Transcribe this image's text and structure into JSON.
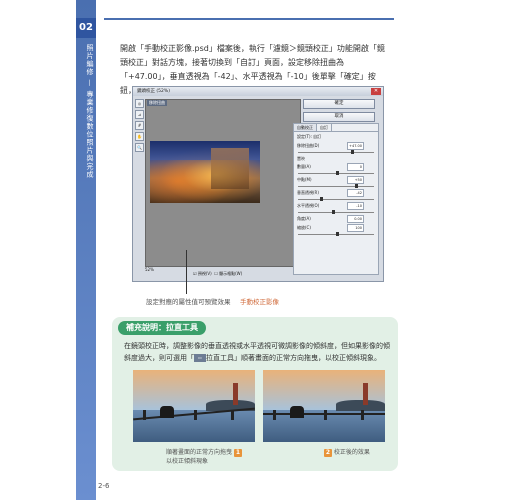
{
  "chapter": {
    "number": "02",
    "side_text": "照片編修 — 專業修復數位照片與完成"
  },
  "body_paragraph": "開啟「手動校正影像.psd」檔案後，執行「濾鏡＞鏡頭校正」功能開啟「鏡頭校正」對話方塊，接著切換到「自訂」頁面，設定移除扭曲為「+47.00」，垂直透視為「-42」、水平透視為「-10」後單擊「確定」按鈕，以校正影像。",
  "dialog": {
    "title": "鏡頭校正 (52%)",
    "preview_label": "移除扭曲",
    "buttons": {
      "ok": "確定",
      "cancel": "取消"
    },
    "tabs": [
      "自動校正",
      "自訂"
    ],
    "rows": [
      {
        "label": "設定(T): 自訂",
        "value": ""
      },
      {
        "label": "移除扭曲(D)",
        "value": "+47.00"
      },
      {
        "label": "暈映",
        "value": ""
      },
      {
        "label": "數量(A)",
        "value": "0"
      },
      {
        "label": "中點(M)",
        "value": "+50"
      },
      {
        "label": "垂直透視(R)",
        "value": "-42"
      },
      {
        "label": "水平透視(O)",
        "value": "-10"
      },
      {
        "label": "角度(A)",
        "value": "0.00"
      },
      {
        "label": "縮放(C)",
        "value": "100"
      }
    ],
    "zoom": "52%",
    "checkbox_labels": [
      "預視(V)",
      "顯示格點(W)"
    ]
  },
  "captions": {
    "left": "設定對應的屬性值可預覽效果",
    "right": "手動校正影像"
  },
  "supplement": {
    "title": "補充說明：拉直工具",
    "text_before": "在鏡頭校正時，調整影像的垂直透視或水平透視可微調影像的傾斜度，但如果影像的傾斜度過大，則可選用「",
    "tool_icon": "ruler-tool-icon",
    "text_after": "拉直工具」順著畫面的正常方向拖曳，以校正傾斜現象。",
    "cap1_line1": "順著畫面的正常方向拖曳",
    "cap1_line2": "以校正傾斜現象",
    "badge1": "1",
    "cap2": "校正後的效果",
    "badge2": "2"
  },
  "page_number": "2-6"
}
